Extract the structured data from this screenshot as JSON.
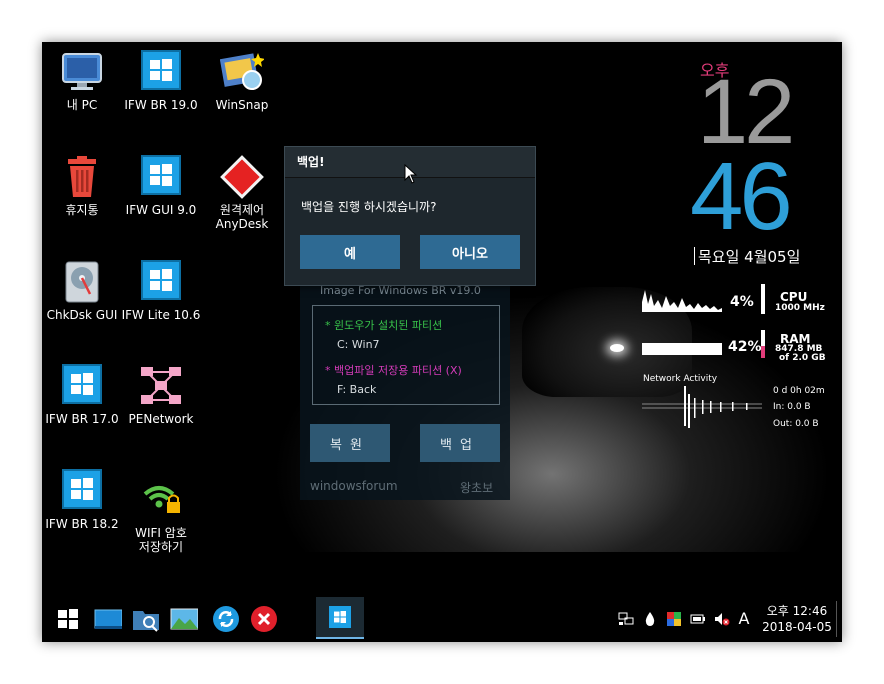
{
  "desktop": {
    "icons": [
      {
        "label1": "내 PC",
        "label2": ""
      },
      {
        "label1": "IFW BR 19.0",
        "label2": ""
      },
      {
        "label1": "WinSnap",
        "label2": ""
      },
      {
        "label1": "휴지통",
        "label2": ""
      },
      {
        "label1": "IFW GUI 9.0",
        "label2": ""
      },
      {
        "label1": "원격제어",
        "label2": "AnyDesk"
      },
      {
        "label1": "ChkDsk GUI",
        "label2": ""
      },
      {
        "label1": "IFW Lite 10.6",
        "label2": ""
      },
      {
        "label1": "IFW BR 17.0",
        "label2": ""
      },
      {
        "label1": "PENetwork",
        "label2": ""
      },
      {
        "label1": "IFW BR 18.2",
        "label2": ""
      },
      {
        "label1": "WIFI 암호",
        "label2": "저장하기"
      }
    ]
  },
  "clock": {
    "ampm": "오후",
    "hour": "12",
    "minute": "46",
    "date": "목요일 4월05일"
  },
  "meters": {
    "cpu_percent": "4%",
    "cpu_label": "CPU",
    "cpu_freq": "1000 MHz",
    "ram_percent": "42%",
    "ram_label": "RAM",
    "ram_used": "847.8 MB",
    "ram_total": "of  2.0 GB",
    "network_label": "Network Activity",
    "uptime": "0 d 0h 02m",
    "net_in": "In: 0.0 B",
    "net_out": "Out: 0.0 B"
  },
  "backup_app": {
    "title": "Image For Windows BR v19.0",
    "partition_os_label": "* 윈도우가 설치된 파티션",
    "partition_os_value": "C:  Win7",
    "partition_store_label": "* 백업파일 저장용 파티션 (X)",
    "partition_store_value": "F:  Back",
    "restore_button": "복원",
    "backup_button": "백업",
    "footer_left": "windowsforum",
    "footer_right": "왕초보"
  },
  "dialog": {
    "title": "백업!",
    "message": "백업을 진행 하시겠습니까?",
    "yes_button": "예",
    "no_button": "아니오"
  },
  "taskbar": {
    "time_ampm": "오후 12:46",
    "date": "2018-04-05",
    "ime_indicator": "A"
  },
  "colors": {
    "accent_blue": "#2e9fd8",
    "accent_pink": "#e23c7a",
    "dialog_button": "#2e6a93",
    "green_text": "#38c24a",
    "magenta_text": "#d33bb8"
  }
}
